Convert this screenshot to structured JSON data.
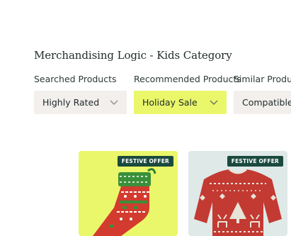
{
  "page": {
    "title": "Merchandising Logic - Kids Category"
  },
  "filters": [
    {
      "label": "Searched Products",
      "value": "Highly Rated"
    },
    {
      "label": "Recommended Products",
      "value": "Holiday Sale"
    },
    {
      "label": "Similar Products",
      "value": "Compatible Items"
    }
  ],
  "products": [
    {
      "badge": "FESTIVE OFFER",
      "image": "christmas-stocking"
    },
    {
      "badge": "FESTIVE OFFER",
      "image": "christmas-sweater"
    }
  ],
  "colors": {
    "accent": "#eaf76a",
    "neutral_field": "#f2efec",
    "badge": "#1a4a3e",
    "card_alt": "#dfe9e7"
  }
}
